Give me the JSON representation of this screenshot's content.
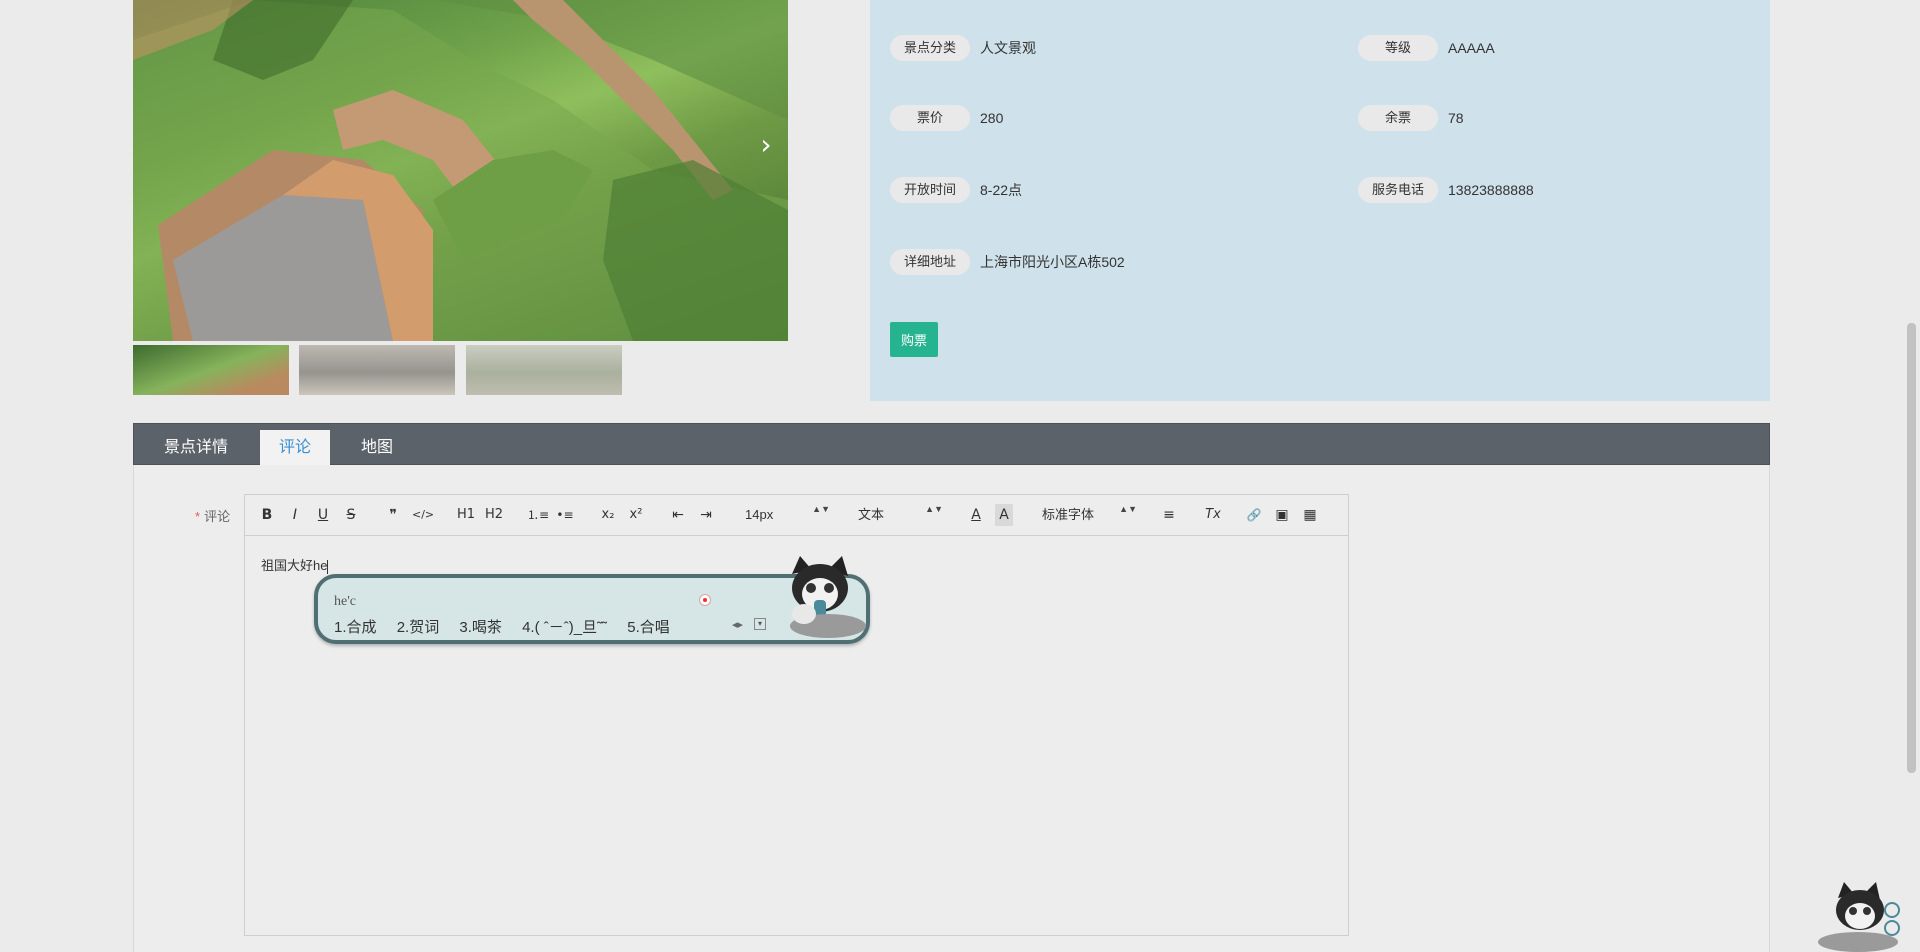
{
  "gallery": {
    "next_label": "›",
    "thumbnails": [
      "thumb-1",
      "thumb-2",
      "thumb-3"
    ]
  },
  "info": {
    "fields": [
      {
        "label": "景点分类",
        "value": "人文景观"
      },
      {
        "label": "等级",
        "value": "AAAAA"
      },
      {
        "label": "票价",
        "value": "280"
      },
      {
        "label": "余票",
        "value": "78"
      },
      {
        "label": "开放时间",
        "value": "8-22点"
      },
      {
        "label": "服务电话",
        "value": "13823888888"
      },
      {
        "label": "详细地址",
        "value": "上海市阳光小区A栋502"
      }
    ],
    "buy_label": "购票"
  },
  "tabs": [
    {
      "label": "景点详情"
    },
    {
      "label": "评论"
    },
    {
      "label": "地图"
    }
  ],
  "comment": {
    "required_mark": "*",
    "label": "评论",
    "text": "祖国大好he"
  },
  "toolbar": {
    "bold": "B",
    "italic": "I",
    "underline": "U",
    "strike": "S",
    "quote": "❞",
    "code": "</>",
    "h1": "H1",
    "h2": "H2",
    "ordered_list": "⒈≡",
    "bullet_list": "•≡",
    "subscript": "x₂",
    "superscript": "x²",
    "outdent": "⇤",
    "indent": "⇥",
    "size_value": "14px",
    "type_value": "文本",
    "color": "A",
    "background": "A",
    "font_value": "标准字体",
    "align": "≡",
    "clear": "Tx",
    "link": "🔗",
    "image": "▣",
    "video": "▦",
    "select_arrows": "▲▼"
  },
  "ime": {
    "input": "he'c",
    "candidates": [
      "1.合成",
      "2.贺词",
      "3.喝茶",
      "4.( ˆ－ˆ)_旦˜˜",
      "5.合唱"
    ],
    "page_arrows": "◂▸",
    "expand": "▾"
  },
  "colors": {
    "panel_bg": "#cfe1ea",
    "buy_button": "#26b38f",
    "tab_bar": "#5c6269",
    "active_tab_text": "#3a8fd1",
    "ime_border": "#4f6f73"
  }
}
